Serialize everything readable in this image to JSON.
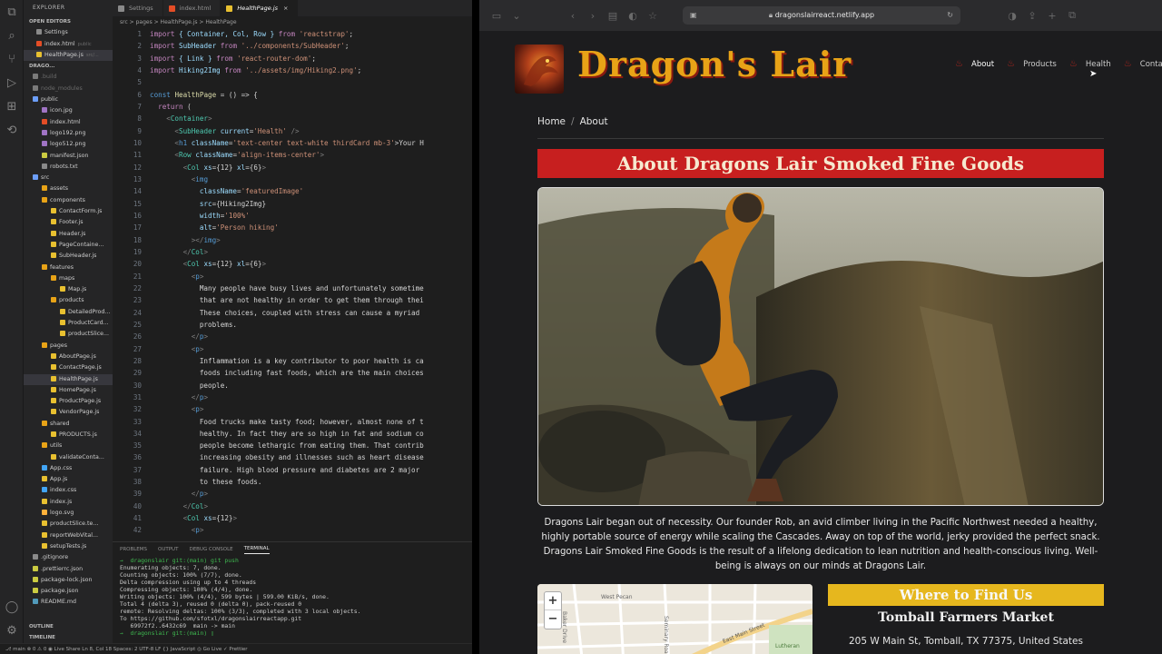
{
  "vscode": {
    "sidebar_title": "EXPLORER",
    "tree": [
      {
        "label": "OPEN EDITORS",
        "type": "sec"
      },
      {
        "label": "Settings",
        "indent": 14,
        "color": "#8a8a8a"
      },
      {
        "label": "index.html",
        "indent": 14,
        "color": "#e44d26",
        "extra": "public"
      },
      {
        "label": "HealthPage.js",
        "indent": 14,
        "color": "#e8c030",
        "sel": true,
        "extra": "src/..."
      },
      {
        "label": "DRAGO...",
        "type": "sec"
      },
      {
        "label": ".build",
        "indent": 10,
        "color": "#7a7a7a",
        "dim": true
      },
      {
        "label": "node_modules",
        "indent": 10,
        "color": "#7a7a7a",
        "dim": true
      },
      {
        "label": "public",
        "indent": 10,
        "color": "#6c9ef8"
      },
      {
        "label": "icon.jpg",
        "indent": 20,
        "color": "#a074c4"
      },
      {
        "label": "index.html",
        "indent": 20,
        "color": "#e44d26"
      },
      {
        "label": "logo192.png",
        "indent": 20,
        "color": "#a074c4"
      },
      {
        "label": "logo512.png",
        "indent": 20,
        "color": "#a074c4"
      },
      {
        "label": "manifest.json",
        "indent": 20,
        "color": "#cbcb41"
      },
      {
        "label": "robots.txt",
        "indent": 20,
        "color": "#8a8a8a"
      },
      {
        "label": "src",
        "indent": 10,
        "color": "#6c9ef8"
      },
      {
        "label": "assets",
        "indent": 20,
        "color": "#e8a317"
      },
      {
        "label": "components",
        "indent": 20,
        "color": "#e8a317"
      },
      {
        "label": "ContactForm.js",
        "indent": 30,
        "color": "#e8c030"
      },
      {
        "label": "Footer.js",
        "indent": 30,
        "color": "#e8c030"
      },
      {
        "label": "Header.js",
        "indent": 30,
        "color": "#e8c030"
      },
      {
        "label": "PageContaine...",
        "indent": 30,
        "color": "#e8c030"
      },
      {
        "label": "SubHeader.js",
        "indent": 30,
        "color": "#e8c030"
      },
      {
        "label": "features",
        "indent": 20,
        "color": "#e8a317"
      },
      {
        "label": "maps",
        "indent": 30,
        "color": "#e8a317"
      },
      {
        "label": "Map.js",
        "indent": 40,
        "color": "#e8c030"
      },
      {
        "label": "products",
        "indent": 30,
        "color": "#e8a317"
      },
      {
        "label": "DetailedProd...",
        "indent": 40,
        "color": "#e8c030"
      },
      {
        "label": "ProductCard...",
        "indent": 40,
        "color": "#e8c030"
      },
      {
        "label": "productSlice...",
        "indent": 40,
        "color": "#e8c030"
      },
      {
        "label": "pages",
        "indent": 20,
        "color": "#e8a317"
      },
      {
        "label": "AboutPage.js",
        "indent": 30,
        "color": "#e8c030"
      },
      {
        "label": "ContactPage.js",
        "indent": 30,
        "color": "#e8c030"
      },
      {
        "label": "HealthPage.js",
        "indent": 30,
        "color": "#e8c030",
        "sel": true
      },
      {
        "label": "HomePage.js",
        "indent": 30,
        "color": "#e8c030"
      },
      {
        "label": "ProductPage.js",
        "indent": 30,
        "color": "#e8c030"
      },
      {
        "label": "VendorPage.js",
        "indent": 30,
        "color": "#e8c030"
      },
      {
        "label": "shared",
        "indent": 20,
        "color": "#e8a317"
      },
      {
        "label": "PRODUCTS.js",
        "indent": 30,
        "color": "#e8c030"
      },
      {
        "label": "utils",
        "indent": 20,
        "color": "#e8a317"
      },
      {
        "label": "validateConta...",
        "indent": 30,
        "color": "#e8c030"
      },
      {
        "label": "App.css",
        "indent": 20,
        "color": "#42a5f5"
      },
      {
        "label": "App.js",
        "indent": 20,
        "color": "#e8c030"
      },
      {
        "label": "index.css",
        "indent": 20,
        "color": "#42a5f5"
      },
      {
        "label": "index.js",
        "indent": 20,
        "color": "#e8c030"
      },
      {
        "label": "logo.svg",
        "indent": 20,
        "color": "#ffb13b"
      },
      {
        "label": "productSlice.te...",
        "indent": 20,
        "color": "#e8c030"
      },
      {
        "label": "reportWebVital...",
        "indent": 20,
        "color": "#e8c030"
      },
      {
        "label": "setupTests.js",
        "indent": 20,
        "color": "#e8c030"
      },
      {
        "label": ".gitignore",
        "indent": 10,
        "color": "#8a8a8a"
      },
      {
        "label": ".prettierrc.json",
        "indent": 10,
        "color": "#cbcb41"
      },
      {
        "label": "package-lock.json",
        "indent": 10,
        "color": "#cbcb41"
      },
      {
        "label": "package.json",
        "indent": 10,
        "color": "#cbcb41"
      },
      {
        "label": "README.md",
        "indent": 10,
        "color": "#519aba"
      }
    ],
    "sidebar_bottom": [
      "OUTLINE",
      "TIMELINE"
    ],
    "tabs": [
      {
        "label": "Settings",
        "color": "#8a8a8a"
      },
      {
        "label": "index.html",
        "color": "#e44d26"
      },
      {
        "label": "HealthPage.js",
        "color": "#e8c030",
        "active": true
      }
    ],
    "breadcrumb": "src > pages > HealthPage.js > HealthPage",
    "code_start_line": 1,
    "code": [
      [
        [
          "import ",
          "#c586c0"
        ],
        [
          "{ Container, Col, Row } ",
          "#9cdcfe"
        ],
        [
          "from ",
          "#c586c0"
        ],
        [
          "'reactstrap'",
          "#ce9178"
        ],
        [
          ";",
          "#d4d4d4"
        ]
      ],
      [
        [
          "import ",
          "#c586c0"
        ],
        [
          "SubHeader ",
          "#9cdcfe"
        ],
        [
          "from ",
          "#c586c0"
        ],
        [
          "'../components/SubHeader'",
          "#ce9178"
        ],
        [
          ";",
          "#d4d4d4"
        ]
      ],
      [
        [
          "import ",
          "#c586c0"
        ],
        [
          "{ Link } ",
          "#9cdcfe"
        ],
        [
          "from ",
          "#c586c0"
        ],
        [
          "'react-router-dom'",
          "#ce9178"
        ],
        [
          ";",
          "#d4d4d4"
        ]
      ],
      [
        [
          "import ",
          "#c586c0"
        ],
        [
          "Hiking2Img ",
          "#9cdcfe"
        ],
        [
          "from ",
          "#c586c0"
        ],
        [
          "'../assets/img/Hiking2.png'",
          "#ce9178"
        ],
        [
          ";",
          "#d4d4d4"
        ]
      ],
      [],
      [
        [
          "const ",
          "#569cd6"
        ],
        [
          "HealthPage",
          "#dcdcaa"
        ],
        [
          " = () => {",
          "#d4d4d4"
        ]
      ],
      [
        [
          "  return ",
          "#c586c0"
        ],
        [
          "(",
          "#d4d4d4"
        ]
      ],
      [
        [
          "    <",
          "#808080"
        ],
        [
          "Container",
          "#4ec9b0"
        ],
        [
          ">",
          "#808080"
        ]
      ],
      [
        [
          "      <",
          "#808080"
        ],
        [
          "SubHeader ",
          "#4ec9b0"
        ],
        [
          "current",
          "#9cdcfe"
        ],
        [
          "=",
          "#d4d4d4"
        ],
        [
          "'Health'",
          "#ce9178"
        ],
        [
          " />",
          "#808080"
        ]
      ],
      [
        [
          "      <",
          "#808080"
        ],
        [
          "h1 ",
          "#569cd6"
        ],
        [
          "className",
          "#9cdcfe"
        ],
        [
          "=",
          "#d4d4d4"
        ],
        [
          "'text-center text-white thirdCard mb-3'",
          "#ce9178"
        ],
        [
          ">Your H",
          "#d4d4d4"
        ]
      ],
      [
        [
          "      <",
          "#808080"
        ],
        [
          "Row ",
          "#4ec9b0"
        ],
        [
          "className",
          "#9cdcfe"
        ],
        [
          "=",
          "#d4d4d4"
        ],
        [
          "'align-items-center'",
          "#ce9178"
        ],
        [
          ">",
          "#808080"
        ]
      ],
      [
        [
          "        <",
          "#808080"
        ],
        [
          "Col ",
          "#4ec9b0"
        ],
        [
          "xs",
          "#9cdcfe"
        ],
        [
          "={12} ",
          "#d4d4d4"
        ],
        [
          "xl",
          "#9cdcfe"
        ],
        [
          "={6}",
          "#d4d4d4"
        ],
        [
          ">",
          "#808080"
        ]
      ],
      [
        [
          "          <",
          "#808080"
        ],
        [
          "img",
          "#569cd6"
        ]
      ],
      [
        [
          "            className",
          "#9cdcfe"
        ],
        [
          "=",
          "#d4d4d4"
        ],
        [
          "'featuredImage'",
          "#ce9178"
        ]
      ],
      [
        [
          "            src",
          "#9cdcfe"
        ],
        [
          "={Hiking2Img}",
          "#d4d4d4"
        ]
      ],
      [
        [
          "            width",
          "#9cdcfe"
        ],
        [
          "=",
          "#d4d4d4"
        ],
        [
          "'100%'",
          "#ce9178"
        ]
      ],
      [
        [
          "            alt",
          "#9cdcfe"
        ],
        [
          "=",
          "#d4d4d4"
        ],
        [
          "'Person hiking'",
          "#ce9178"
        ]
      ],
      [
        [
          "          ></",
          "#808080"
        ],
        [
          "img",
          "#569cd6"
        ],
        [
          ">",
          "#808080"
        ]
      ],
      [
        [
          "        </",
          "#808080"
        ],
        [
          "Col",
          "#4ec9b0"
        ],
        [
          ">",
          "#808080"
        ]
      ],
      [
        [
          "        <",
          "#808080"
        ],
        [
          "Col ",
          "#4ec9b0"
        ],
        [
          "xs",
          "#9cdcfe"
        ],
        [
          "={12} ",
          "#d4d4d4"
        ],
        [
          "xl",
          "#9cdcfe"
        ],
        [
          "={6}",
          "#d4d4d4"
        ],
        [
          ">",
          "#808080"
        ]
      ],
      [
        [
          "          <",
          "#808080"
        ],
        [
          "p",
          "#569cd6"
        ],
        [
          ">",
          "#808080"
        ]
      ],
      [
        [
          "            Many people have busy lives and unfortunately sometime",
          "#d4d4d4"
        ]
      ],
      [
        [
          "            that are not healthy in order to get them through thei",
          "#d4d4d4"
        ]
      ],
      [
        [
          "            These choices, coupled with stress can cause a myriad",
          "#d4d4d4"
        ]
      ],
      [
        [
          "            problems.",
          "#d4d4d4"
        ]
      ],
      [
        [
          "          </",
          "#808080"
        ],
        [
          "p",
          "#569cd6"
        ],
        [
          ">",
          "#808080"
        ]
      ],
      [
        [
          "          <",
          "#808080"
        ],
        [
          "p",
          "#569cd6"
        ],
        [
          ">",
          "#808080"
        ]
      ],
      [
        [
          "            Inflammation is a key contributor to poor health is ca",
          "#d4d4d4"
        ]
      ],
      [
        [
          "            foods including fast foods, which are the main choices",
          "#d4d4d4"
        ]
      ],
      [
        [
          "            people.",
          "#d4d4d4"
        ]
      ],
      [
        [
          "          </",
          "#808080"
        ],
        [
          "p",
          "#569cd6"
        ],
        [
          ">",
          "#808080"
        ]
      ],
      [
        [
          "          <",
          "#808080"
        ],
        [
          "p",
          "#569cd6"
        ],
        [
          ">",
          "#808080"
        ]
      ],
      [
        [
          "            Food trucks make tasty food; however, almost none of t",
          "#d4d4d4"
        ]
      ],
      [
        [
          "            healthy. In fact they are so high in fat and sodium co",
          "#d4d4d4"
        ]
      ],
      [
        [
          "            people become lethargic from eating them. That contrib",
          "#d4d4d4"
        ]
      ],
      [
        [
          "            increasing obesity and illnesses such as heart disease",
          "#d4d4d4"
        ]
      ],
      [
        [
          "            failure. High blood pressure and diabetes are 2 major",
          "#d4d4d4"
        ]
      ],
      [
        [
          "            to these foods.",
          "#d4d4d4"
        ]
      ],
      [
        [
          "          </",
          "#808080"
        ],
        [
          "p",
          "#569cd6"
        ],
        [
          ">",
          "#808080"
        ]
      ],
      [
        [
          "        </",
          "#808080"
        ],
        [
          "Col",
          "#4ec9b0"
        ],
        [
          ">",
          "#808080"
        ]
      ],
      [
        [
          "        <",
          "#808080"
        ],
        [
          "Col ",
          "#4ec9b0"
        ],
        [
          "xs",
          "#9cdcfe"
        ],
        [
          "={12}",
          "#d4d4d4"
        ],
        [
          ">",
          "#808080"
        ]
      ],
      [
        [
          "          <",
          "#808080"
        ],
        [
          "p",
          "#569cd6"
        ],
        [
          ">",
          "#808080"
        ]
      ]
    ],
    "panel_tabs": [
      "PROBLEMS",
      "OUTPUT",
      "DEBUG CONSOLE",
      "TERMINAL"
    ],
    "panel_active": "TERMINAL",
    "terminal": [
      "→  dragonslair git:(main) git push",
      "Enumerating objects: 7, done.",
      "Counting objects: 100% (7/7), done.",
      "Delta compression using up to 4 threads",
      "Compressing objects: 100% (4/4), done.",
      "Writing objects: 100% (4/4), 599 bytes | 599.00 KiB/s, done.",
      "Total 4 (delta 3), reused 0 (delta 0), pack-reused 0",
      "remote: Resolving deltas: 100% (3/3), completed with 3 local objects.",
      "To https://github.com/sfotxl/dragonslairreactapp.git",
      "   69972f2..6432c69  main -> main",
      "→  dragonslair git:(main) ▯"
    ],
    "statusbar": "⎇ main   ⊗ 0 ⚠ 0   ◉ Live Share          Ln 8, Col 18   Spaces: 2   UTF-8   LF   {} JavaScript   ◎ Go Live   ✓ Prettier"
  },
  "browser": {
    "url": "dragonslairreact.netlify.app",
    "logo_text": "Dragon's Lair",
    "nav": [
      {
        "label": "About",
        "current": true
      },
      {
        "label": "Products"
      },
      {
        "label": "Health"
      },
      {
        "label": "Contact"
      }
    ],
    "breadcrumb": [
      "Home",
      "About"
    ],
    "banner": "About Dragons Lair Smoked Fine Goods",
    "hero_alt": "Person hiking",
    "paragraph": "Dragons Lair began out of necessity. Our founder Rob, an avid climber living in the Pacific Northwest needed a healthy, highly portable source of energy while scaling the Cascades. Away on top of the world, jerky provided the perfect snack. Dragons Lair Smoked Fine Goods is the result of a lifelong dedication to lean nutrition and health-conscious living. Well-being is always on our minds at Dragons Lair.",
    "map_zoom_in": "+",
    "map_zoom_out": "−",
    "map_labels": [
      "Baker Drive",
      "West Pecan",
      "Seminary Road",
      "East Main Street",
      "Lutheran"
    ],
    "find_us": "Where to Find Us",
    "market": "Tomball Farmers Market",
    "address": "205 W Main St, Tomball, TX 77375, United States"
  }
}
